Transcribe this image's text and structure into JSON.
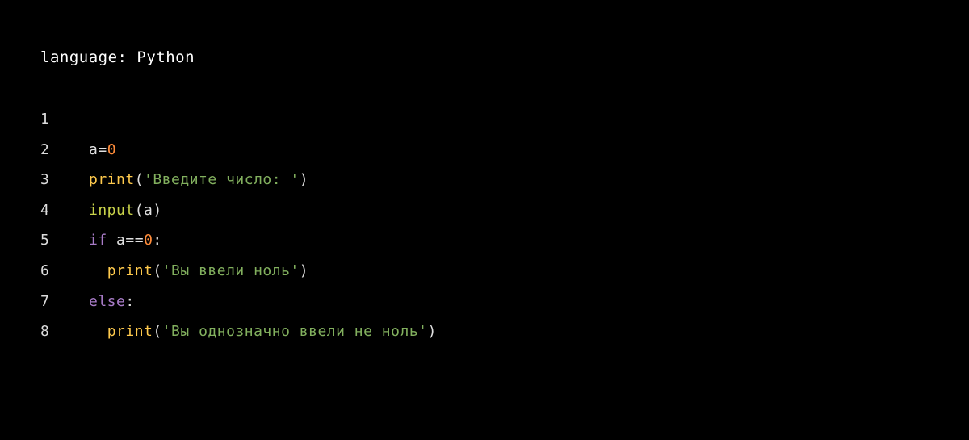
{
  "header": {
    "language_label": "language: ",
    "language_value": "Python"
  },
  "code": {
    "lines": [
      {
        "num": "1"
      },
      {
        "num": "2",
        "var1": "a",
        "op1": "=",
        "num1": "0"
      },
      {
        "num": "3",
        "func1": "print",
        "paren1": "(",
        "str1": "'Введите число: '",
        "paren2": ")"
      },
      {
        "num": "4",
        "func1": "input",
        "paren1": "(",
        "var1": "a",
        "paren2": ")"
      },
      {
        "num": "5",
        "kw1": "if",
        "sp1": " ",
        "var1": "a",
        "op1": "==",
        "num1": "0",
        "colon1": ":"
      },
      {
        "num": "6",
        "indent1": "  ",
        "func1": "print",
        "paren1": "(",
        "str1": "'Вы ввели ноль'",
        "paren2": ")"
      },
      {
        "num": "7",
        "kw1": "else",
        "colon1": ":"
      },
      {
        "num": "8",
        "indent1": "  ",
        "func1": "print",
        "paren1": "(",
        "str1": "'Вы однозначно ввели не ноль'",
        "paren2": ")"
      }
    ]
  }
}
